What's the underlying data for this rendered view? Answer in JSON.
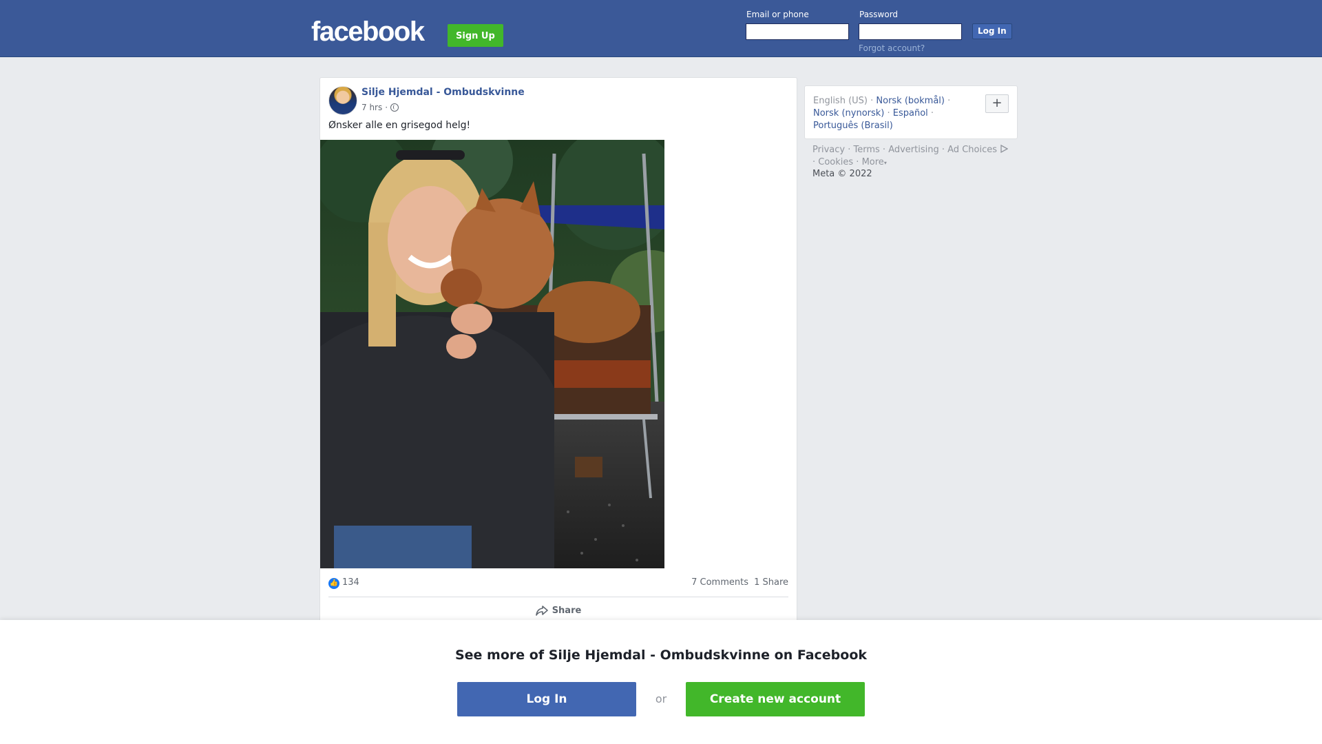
{
  "header": {
    "logo": "facebook",
    "signup_label": "Sign Up",
    "email_label": "Email or phone",
    "password_label": "Password",
    "email_value": "",
    "password_value": "",
    "login_label": "Log In",
    "forgot_label": "Forgot account?"
  },
  "post": {
    "author": "Silje Hjemdal - Ombudskvinne",
    "time": "7 hrs",
    "separator": "·",
    "privacy_icon": "globe-icon",
    "text": "Ønsker alle en grisegod helg!",
    "like_count": "134",
    "comments": "7 Comments",
    "shares": "1 Share",
    "share_label": "Share"
  },
  "sidebar": {
    "current_language": "English (US)",
    "languages": [
      "Norsk (bokmål)",
      "Norsk (nynorsk)",
      "Español",
      "Português (Brasil)"
    ],
    "more_languages_label": "+",
    "links": [
      "Privacy",
      "Terms",
      "Advertising",
      "Ad Choices",
      "Cookies",
      "More"
    ],
    "copyright": "Meta © 2022"
  },
  "overlay": {
    "title": "See more of Silje Hjemdal - Ombudskvinne on Facebook",
    "login_label": "Log In",
    "or_label": "or",
    "create_label": "Create new account"
  },
  "colors": {
    "brand": "#3b5998",
    "button_blue": "#4267b2",
    "green": "#42b72a",
    "link": "#385898"
  }
}
